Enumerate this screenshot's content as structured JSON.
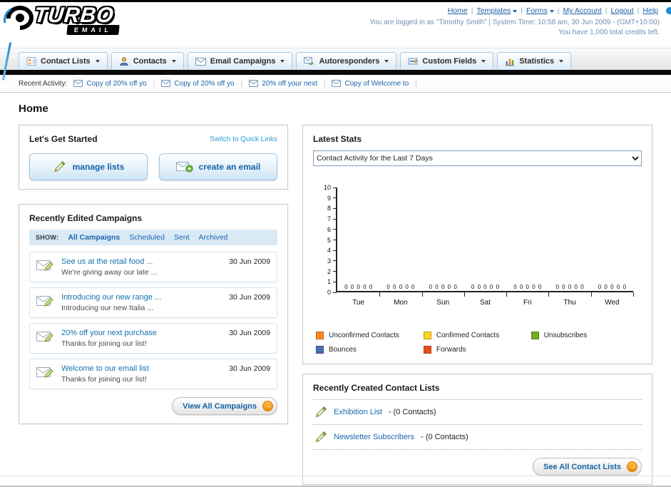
{
  "header": {
    "logo_text": "TURBO",
    "logo_sub": "EMAIL",
    "nav_links": [
      {
        "label": "Home",
        "dropdown": false
      },
      {
        "label": "Templates",
        "dropdown": true
      },
      {
        "label": "Forms",
        "dropdown": true
      },
      {
        "label": "My Account",
        "dropdown": false
      },
      {
        "label": "Logout",
        "dropdown": false
      },
      {
        "label": "Help",
        "dropdown": false
      }
    ],
    "login_info": "You are logged in as \"Timothy Smith\" | System Time: 10:58 am, 30 Jun 2009 - (GMT+10:00)",
    "credits_info": "You have 1,000 total credits left."
  },
  "nav_tabs": [
    {
      "label": "Contact Lists",
      "icon": "contact-lists-icon"
    },
    {
      "label": "Contacts",
      "icon": "contacts-icon"
    },
    {
      "label": "Email Campaigns",
      "icon": "email-campaigns-icon"
    },
    {
      "label": "Autoresponders",
      "icon": "autoresponders-icon"
    },
    {
      "label": "Custom Fields",
      "icon": "custom-fields-icon"
    },
    {
      "label": "Statistics",
      "icon": "statistics-icon"
    }
  ],
  "recent_activity": {
    "label": "Recent Activity:",
    "items": [
      "Copy of 20% off yo",
      "Copy of 20% off yo",
      "20% off your next",
      "Copy of Welcome to"
    ]
  },
  "page_title": "Home",
  "get_started": {
    "title": "Let's Get Started",
    "switch_link": "Switch to Quick Links",
    "buttons": [
      {
        "label": "manage lists",
        "icon": "manage-lists-icon"
      },
      {
        "label": "create an email",
        "icon": "create-email-icon"
      }
    ]
  },
  "campaigns": {
    "title": "Recently Edited Campaigns",
    "show_label": "SHOW:",
    "filters": [
      "All Campaigns",
      "Scheduled",
      "Sent",
      "Archived"
    ],
    "active_filter": "All Campaigns",
    "items": [
      {
        "title": "See us at the retail food ...",
        "subtitle": "We're giving away our late ...",
        "date": "30 Jun 2009"
      },
      {
        "title": "Introducing our new range ...",
        "subtitle": "Introducing our new Italia ...",
        "date": "30 Jun 2009"
      },
      {
        "title": "20% off your next purchase",
        "subtitle": "Thanks for joining our list!",
        "date": "30 Jun 2009"
      },
      {
        "title": "Welcome to our email list",
        "subtitle": "Thanks for joining our list!",
        "date": "30 Jun 2009"
      }
    ],
    "view_all_label": "View All Campaigns"
  },
  "latest_stats": {
    "title": "Latest Stats",
    "dropdown_value": "Contact Activity for the Last 7 Days"
  },
  "chart_data": {
    "type": "bar",
    "title": "Contact Activity for the Last 7 Days",
    "categories": [
      "Tue",
      "Mon",
      "Sun",
      "Sat",
      "Fri",
      "Thu",
      "Wed"
    ],
    "yticks": [
      "10",
      "9",
      "8",
      "7",
      "6",
      "5",
      "4",
      "3",
      "2",
      "1",
      "0"
    ],
    "ylim": [
      0,
      10
    ],
    "grid": false,
    "legend_position": "bottom",
    "series": [
      {
        "name": "Unconfirmed Contacts",
        "color": "#FF8A24",
        "values": [
          0,
          0,
          0,
          0,
          0,
          0,
          0
        ]
      },
      {
        "name": "Confirmed Contacts",
        "color": "#FFD51E",
        "values": [
          0,
          0,
          0,
          0,
          0,
          0,
          0
        ]
      },
      {
        "name": "Unsubscribes",
        "color": "#6FAE1F",
        "values": [
          0,
          0,
          0,
          0,
          0,
          0,
          0
        ]
      },
      {
        "name": "Bounces",
        "color": "#4F6FAD",
        "values": [
          0,
          0,
          0,
          0,
          0,
          0,
          0
        ]
      },
      {
        "name": "Forwards",
        "color": "#E8501E",
        "values": [
          0,
          0,
          0,
          0,
          0,
          0,
          0
        ]
      }
    ]
  },
  "contact_lists": {
    "title": "Recently Created Contact Lists",
    "items": [
      {
        "name": "Exhibition List",
        "detail": "- (0 Contacts)"
      },
      {
        "name": "Newsletter Subscribers",
        "detail": "- (0 Contacts)"
      }
    ],
    "see_all_label": "See All Contact Lists"
  }
}
